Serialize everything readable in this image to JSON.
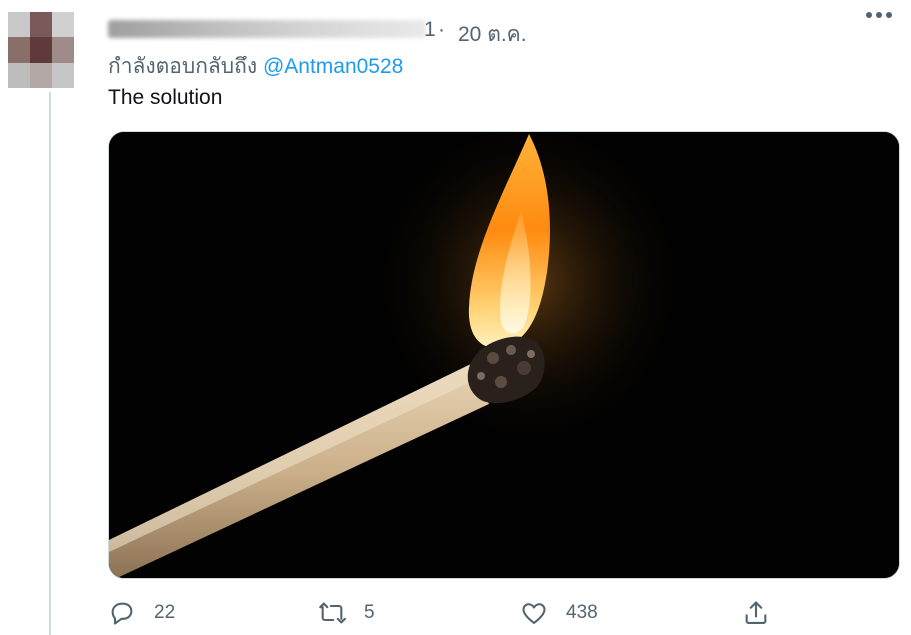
{
  "tweet": {
    "author_handle_tail": "1",
    "separator": "·",
    "date": "20 ต.ค.",
    "replying_prefix": "กำลังตอบกลับถึง",
    "replying_to": "@Antman0528",
    "text": "The solution"
  },
  "media": {
    "subject": "burning match"
  },
  "actions": {
    "reply_count": "22",
    "retweet_count": "5",
    "like_count": "438"
  },
  "colors": {
    "link": "#1d9bf0",
    "secondary_text": "#536471",
    "border": "#cfd9de"
  },
  "icons": [
    "more-icon",
    "reply-icon",
    "retweet-icon",
    "like-icon",
    "share-icon"
  ]
}
